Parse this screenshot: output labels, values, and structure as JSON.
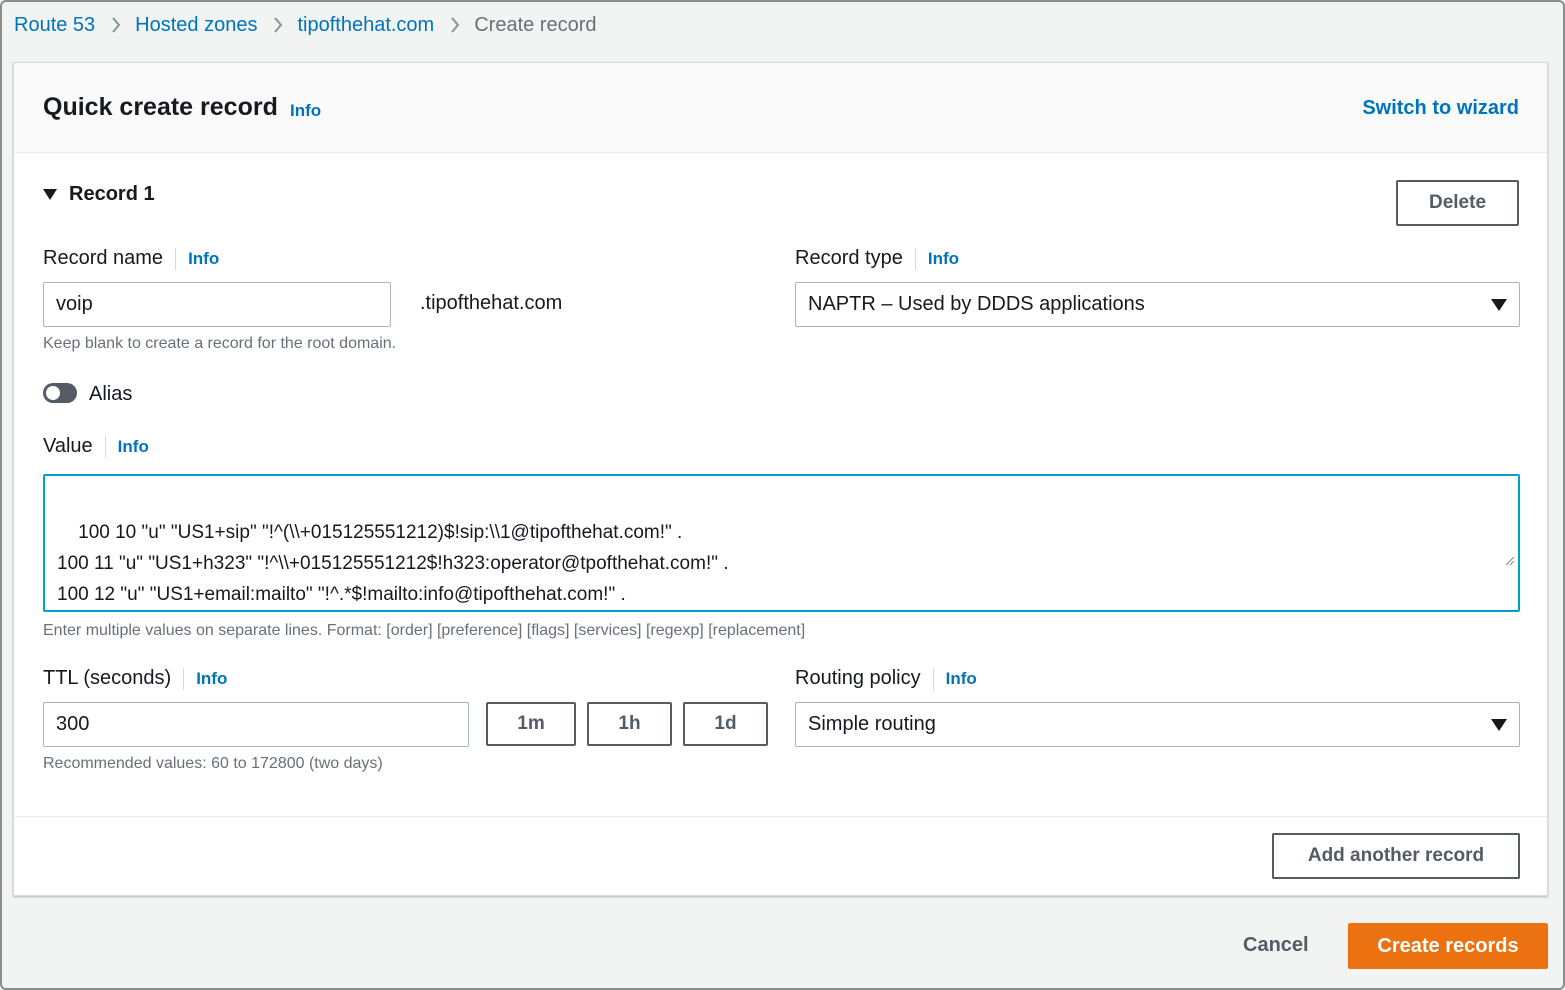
{
  "breadcrumb": {
    "items": [
      "Route 53",
      "Hosted zones",
      "tipofthehat.com"
    ],
    "current": "Create record"
  },
  "card": {
    "title": "Quick create record",
    "title_info": "Info",
    "switch_wizard": "Switch to wizard"
  },
  "record": {
    "heading": "Record 1",
    "delete_label": "Delete",
    "name": {
      "label": "Record name",
      "info": "Info",
      "value": "voip",
      "suffix": ".tipofthehat.com",
      "hint": "Keep blank to create a record for the root domain."
    },
    "type": {
      "label": "Record type",
      "info": "Info",
      "selected": "NAPTR – Used by DDDS applications"
    },
    "alias": {
      "label": "Alias",
      "enabled": false
    },
    "value": {
      "label": "Value",
      "info": "Info",
      "text": "100 10 \"u\" \"US1+sip\" \"!^(\\\\+015125551212)$!sip:\\\\1@tipofthehat.com!\" .\n100 11 \"u\" \"US1+h323\" \"!^\\\\+015125551212$!h323:operator@tpofthehat.com!\" .\n100 12 \"u\" \"US1+email:mailto\" \"!^.*$!mailto:info@tipofthehat.com!\" .",
      "hint": "Enter multiple values on separate lines. Format: [order] [preference] [flags] [services] [regexp] [replacement]"
    },
    "ttl": {
      "label": "TTL (seconds)",
      "info": "Info",
      "value": "300",
      "presets": [
        "1m",
        "1h",
        "1d"
      ],
      "hint": "Recommended values: 60 to 172800 (two days)"
    },
    "routing": {
      "label": "Routing policy",
      "info": "Info",
      "selected": "Simple routing"
    }
  },
  "actions": {
    "add_another": "Add another record",
    "cancel": "Cancel",
    "create": "Create records"
  },
  "colors": {
    "link": "#0073bb",
    "primary": "#ec7211",
    "focus": "#00a1c9"
  }
}
